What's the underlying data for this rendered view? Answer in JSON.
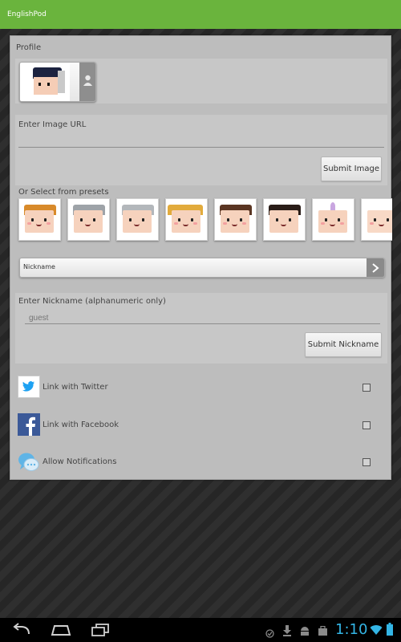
{
  "app": {
    "title": "EnglishPod"
  },
  "profile": {
    "label": "Profile"
  },
  "image_url": {
    "label": "Enter Image URL",
    "value": "",
    "submit_label": "Submit Image"
  },
  "presets": {
    "label": "Or Select from presets",
    "items": [
      "preset-1",
      "preset-2",
      "preset-3",
      "preset-4",
      "preset-5",
      "preset-6",
      "preset-7",
      "preset-8"
    ]
  },
  "nickname_bar": {
    "label": "Nickname"
  },
  "nickname": {
    "label": "Enter Nickname (alphanumeric only)",
    "placeholder": "guest",
    "submit_label": "Submit Nickname"
  },
  "links": [
    {
      "label": "Link with Twitter",
      "icon": "twitter-icon",
      "checked": false
    },
    {
      "label": "Link with Facebook",
      "icon": "facebook-icon",
      "checked": false
    },
    {
      "label": "Allow Notifications",
      "icon": "chat-bubbles-icon",
      "checked": false
    }
  ],
  "status_bar": {
    "time": "1:10"
  },
  "colors": {
    "accent": "#6ab43d",
    "twitter": "#1da1f2",
    "facebook": "#3b5998"
  }
}
